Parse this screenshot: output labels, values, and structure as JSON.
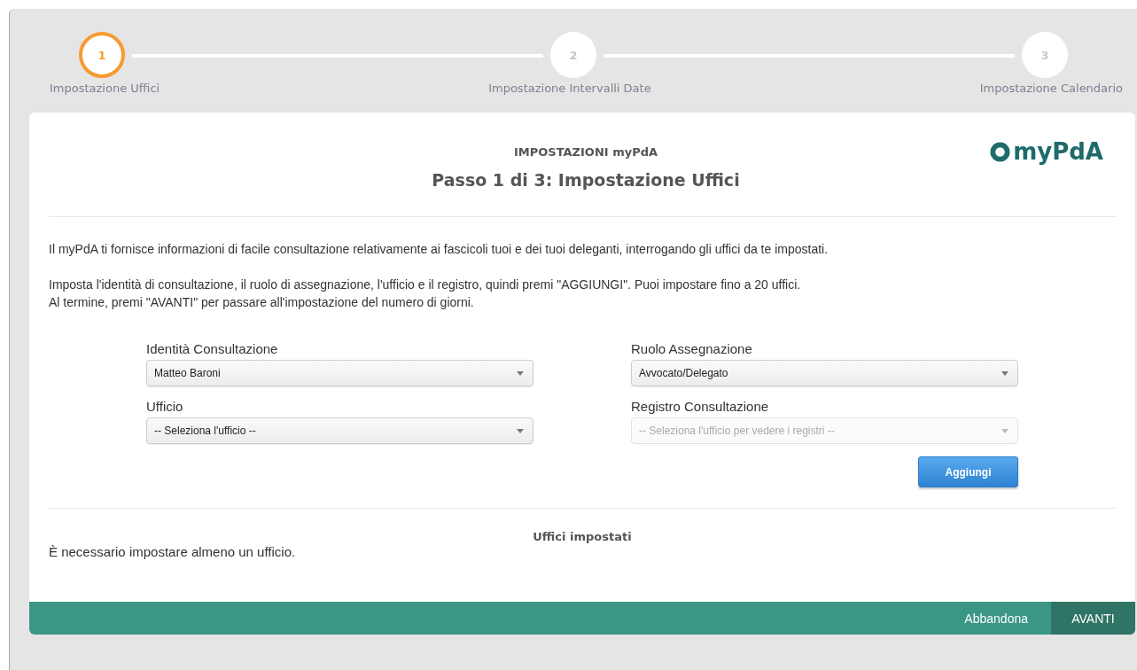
{
  "steps": [
    {
      "number": "1",
      "label": "Impostazione Uffici",
      "selected": true
    },
    {
      "number": "2",
      "label": "Impostazione Intervalli Date",
      "selected": false
    },
    {
      "number": "3",
      "label": "Impostazione Calendario",
      "selected": false
    }
  ],
  "header": {
    "subtitle": "IMPOSTAZIONI myPdA",
    "title": "Passo 1 di 3: Impostazione Uffici",
    "logo": "myPdA"
  },
  "intro": [
    "Il myPdA ti fornisce informazioni di facile consultazione relativamente ai fascicoli tuoi e dei tuoi deleganti, interrogando gli uffici da te impostati.",
    "Imposta l'identità di consultazione, il ruolo di assegnazione, l'ufficio e il registro, quindi premi \"AGGIUNGI\". Puoi impostare fino a 20 uffici.",
    "Al termine, premi \"AVANTI\" per passare all'impostazione del numero di giorni."
  ],
  "fields": [
    {
      "label": "Identità Consultazione",
      "value": "Matteo Baroni",
      "disabled": false
    },
    {
      "label": "Ruolo Assegnazione",
      "value": "Avvocato/Delegato",
      "disabled": false
    },
    {
      "label": "Ufficio",
      "value": "-- Seleziona l'ufficio --",
      "disabled": false
    },
    {
      "label": "Registro Consultazione",
      "value": "-- Seleziona l'ufficio per vedere i registri --",
      "disabled": true
    }
  ],
  "add_button": "Aggiungi",
  "offices": {
    "title": "Uffici impostati",
    "message": "È necessario impostare almeno un ufficio."
  },
  "footer": {
    "cancel": "Abbandona",
    "next": "AVANTI"
  }
}
